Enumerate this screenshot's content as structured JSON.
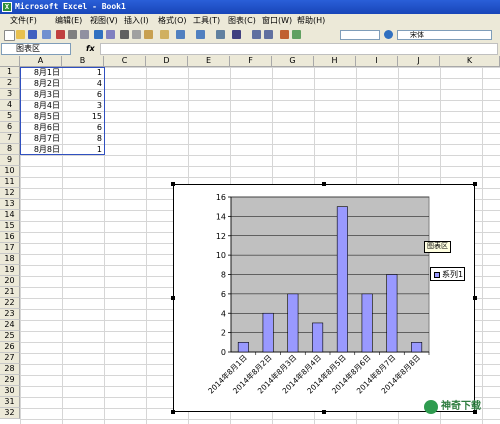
{
  "window": {
    "title": "Microsoft Excel - Book1",
    "app_icon": "X"
  },
  "menu": [
    "文件(F)",
    "编辑(E)",
    "视图(V)",
    "插入(I)",
    "格式(O)",
    "工具(T)",
    "图表(C)",
    "窗口(W)",
    "帮助(H)"
  ],
  "toolbar": {
    "font_name": "宋体"
  },
  "formula_bar": {
    "name_box": "图表区",
    "fx": "fx",
    "content": ""
  },
  "columns": [
    "A",
    "B",
    "C",
    "D",
    "E",
    "F",
    "G",
    "H",
    "I",
    "J",
    "K"
  ],
  "rows": [
    "1",
    "2",
    "3",
    "4",
    "5",
    "6",
    "7",
    "8",
    "9",
    "10",
    "11",
    "12",
    "13",
    "14",
    "15",
    "16",
    "17",
    "18",
    "19",
    "20",
    "21",
    "22",
    "23",
    "24",
    "25",
    "26",
    "27",
    "28",
    "29",
    "30",
    "31",
    "32"
  ],
  "cells": [
    {
      "a": "8月1日",
      "b": "1"
    },
    {
      "a": "8月2日",
      "b": "4"
    },
    {
      "a": "8月3日",
      "b": "6"
    },
    {
      "a": "8月4日",
      "b": "3"
    },
    {
      "a": "8月5日",
      "b": "15"
    },
    {
      "a": "8月6日",
      "b": "6"
    },
    {
      "a": "8月7日",
      "b": "8"
    },
    {
      "a": "8月8日",
      "b": "1"
    }
  ],
  "chart_tooltip": "图表区",
  "watermark": "神奇下载",
  "colors": {
    "bar": "#9999ff",
    "plot_bg": "#c0c0c0",
    "title_bar": "#1845b8"
  },
  "chart_data": {
    "type": "bar",
    "categories": [
      "2014年8月1日",
      "2014年8月2日",
      "2014年8月3日",
      "2014年8月4日",
      "2014年8月5日",
      "2014年8月6日",
      "2014年8月7日",
      "2014年8月8日"
    ],
    "series": [
      {
        "name": "系列1",
        "values": [
          1,
          4,
          6,
          3,
          15,
          6,
          8,
          1
        ]
      }
    ],
    "ylim": [
      0,
      16
    ],
    "yticks": [
      0,
      2,
      4,
      6,
      8,
      10,
      12,
      14,
      16
    ],
    "grid": true,
    "legend": "right"
  }
}
